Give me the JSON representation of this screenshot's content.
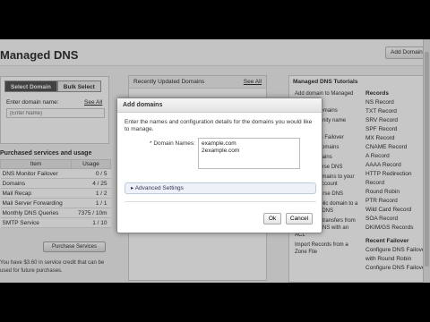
{
  "page": {
    "title": "Managed DNS",
    "add_button": "Add Domains"
  },
  "left": {
    "tabs": [
      {
        "label": "Select Domain"
      },
      {
        "label": "Bulk Select"
      }
    ],
    "enter_label": "Enter domain name:",
    "see_all": "See All",
    "search_placeholder": "(Enter Name)"
  },
  "usage": {
    "title": "Purchased services and usage",
    "columns": [
      "Item",
      "Usage"
    ],
    "rows": [
      {
        "item": "DNS Monitor Failover",
        "usage": "0 / 5"
      },
      {
        "item": "Domains",
        "usage": "4 / 25"
      },
      {
        "item": "Mail Recap",
        "usage": "1 / 2"
      },
      {
        "item": "Mail Server Forwarding",
        "usage": "1 / 1"
      },
      {
        "item": "Monthly DNS Queries",
        "usage": "7375 / 10m"
      },
      {
        "item": "SMTP Service",
        "usage": "1 / 10"
      }
    ],
    "purchase_button": "Purchase Services",
    "credit_note": "You have $3.60 in service credit that can be used for future purchases."
  },
  "middle": {
    "title": "Recently Updated Domains",
    "see_all": "See All"
  },
  "tutorials": {
    "title": "Managed DNS Tutorials",
    "items": [
      "Add domain to Managed DNS",
      "Bulk add domains",
      "Create a vanity name server",
      "Set up DNS Failover",
      "Managed domains",
      "Delete domains",
      "Set up reverse DNS",
      "Transfer domains to your Managed account",
      "Setup Reverse DNS",
      "Apply a public domain to a Secondary DNS",
      "Allow zone transfers from Managed DNS with an ACL",
      "Import Records from a Zone File"
    ]
  },
  "records": {
    "heading": "Records",
    "items": [
      "NS Record",
      "TXT Record",
      "SRV Record",
      "SPF Record",
      "MX Record",
      "CNAME Record",
      "A Record",
      "AAAA Record",
      "HTTP Redirection Record",
      "Round Robin",
      "PTR Record",
      "Wild Card Record",
      "SOA Record",
      "DKIM/GS Records"
    ],
    "failover_heading": "Recent Failover",
    "failover_items": [
      "Configure DNS Failover with Round Robin",
      "Configure DNS Failover"
    ]
  },
  "dialog": {
    "title": "Add domains",
    "instructions": "Enter the names and configuration details for the domains you would like to manage.",
    "field_label": "* Domain Names:",
    "field_value": "example.com\n2example.com",
    "advanced_label": "Advanced Settings",
    "ok": "Ok",
    "cancel": "Cancel"
  },
  "colors": {
    "tab_active": "#555555",
    "overlay": "rgba(0,0,0,0.22)"
  }
}
